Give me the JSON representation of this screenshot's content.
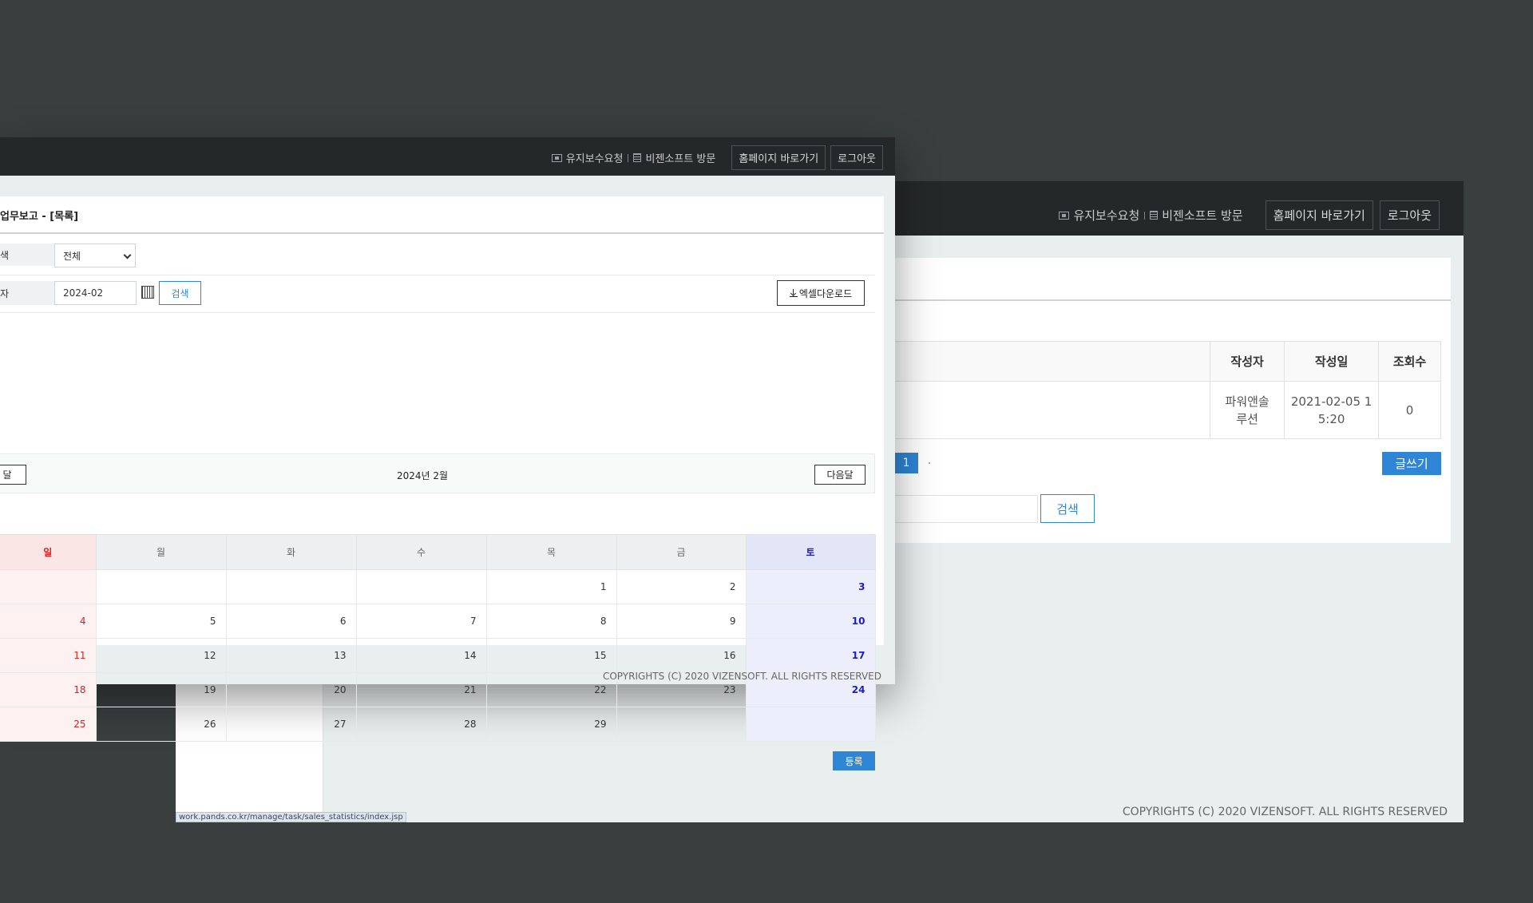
{
  "back_window": {
    "header_links": {
      "maintenance": "유지보수요청",
      "visit": "비젠소프트 방문",
      "homepage_btn": "홈페이지 바로가기",
      "logout_btn": "로그아웃"
    },
    "table": {
      "headers": [
        "작성자",
        "작성일",
        "조회수"
      ],
      "rows": [
        {
          "author": "파워앤솔\n루션",
          "date": "2021-02-05 1\n5:20",
          "views": "0"
        }
      ]
    },
    "pagination": {
      "current": "1"
    },
    "write_btn": "글쓰기",
    "search_btn": "검색",
    "copyright": "COPYRIGHTS (C) 2020 VIZENSOFT. ALL RIGHTS RESERVED",
    "status_url": "work.pands.co.kr/manage/task/sales_statistics/index.jsp"
  },
  "front_window": {
    "header_links": {
      "maintenance": "유지보수요청",
      "visit": "비젠소프트 방문",
      "homepage_btn": "홈페이지 바로가기",
      "logout_btn": "로그아웃"
    },
    "title": "업무보고 - [목록]",
    "filter": {
      "search_label": "색",
      "select_value": "전체",
      "date_label": "자",
      "date_value": "2024-02",
      "search_btn": "검색",
      "excel_btn": "엑셀다운로드"
    },
    "month_nav": {
      "prev": "달",
      "label": "2024년 2월",
      "next": "다음달"
    },
    "calendar": {
      "weekdays": [
        "일",
        "월",
        "화",
        "수",
        "목",
        "금",
        "토"
      ],
      "weeks": [
        [
          "",
          "",
          "",
          "",
          "1",
          "2",
          "3"
        ],
        [
          "4",
          "5",
          "6",
          "7",
          "8",
          "9",
          "10"
        ],
        [
          "11",
          "12",
          "13",
          "14",
          "15",
          "16",
          "17"
        ],
        [
          "18",
          "19",
          "20",
          "21",
          "22",
          "23",
          "24"
        ],
        [
          "25",
          "26",
          "27",
          "28",
          "29",
          "",
          ""
        ]
      ]
    },
    "register_btn": "등록",
    "copyright": "COPYRIGHTS (C) 2020 VIZENSOFT. ALL RIGHTS RESERVED"
  }
}
